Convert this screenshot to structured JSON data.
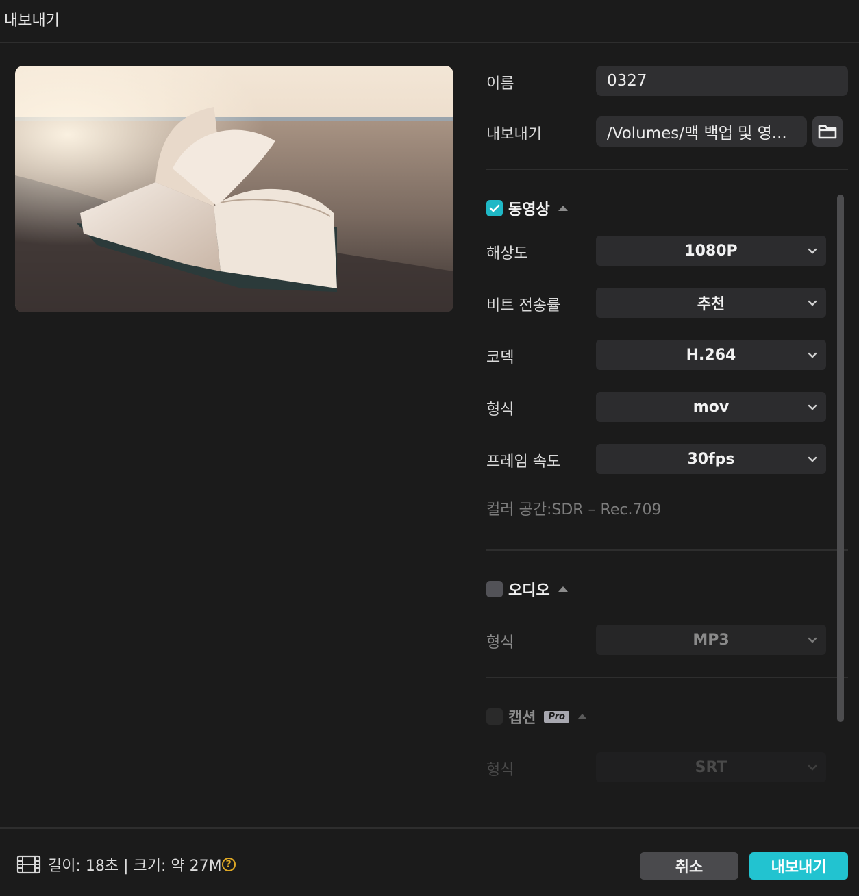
{
  "window": {
    "title": "내보내기"
  },
  "export": {
    "name_label": "이름",
    "name_value": "0327",
    "path_label": "내보내기",
    "path_value": "/Volumes/맥 백업 및 영...",
    "folder_icon": "folder-icon"
  },
  "video": {
    "section_label": "동영상",
    "enabled": true,
    "resolution_label": "해상도",
    "resolution_value": "1080P",
    "bitrate_label": "비트 전송률",
    "bitrate_value": "추천",
    "codec_label": "코덱",
    "codec_value": "H.264",
    "format_label": "형식",
    "format_value": "mov",
    "framerate_label": "프레임 속도",
    "framerate_value": "30fps",
    "colorspace": "컬러 공간:SDR – Rec.709"
  },
  "audio": {
    "section_label": "오디오",
    "enabled": false,
    "format_label": "형식",
    "format_value": "MP3"
  },
  "captions": {
    "section_label": "캡션",
    "badge": "Pro",
    "enabled": false,
    "format_label": "형식",
    "format_value": "SRT"
  },
  "footer": {
    "info": "길이: 18초 | 크기: 약 27M",
    "help_icon": "?",
    "cancel_label": "취소",
    "export_label": "내보내기"
  },
  "colors": {
    "accent": "#22c3d0",
    "background": "#1b1b1b",
    "field": "#2f2f31"
  }
}
